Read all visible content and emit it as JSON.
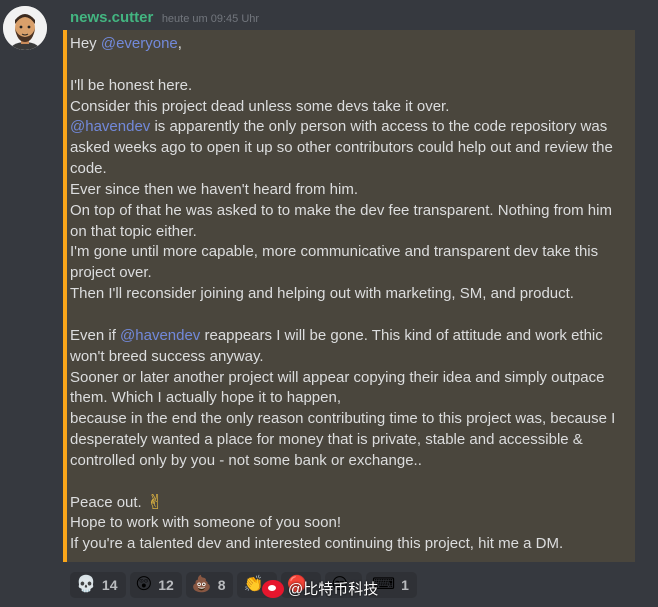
{
  "author": {
    "username": "news.cutter",
    "timestamp": "heute um 09:45 Uhr"
  },
  "message": {
    "accent_color": "#faa61a",
    "lines": [
      [
        {
          "text": "Hey "
        },
        {
          "text": "@everyone",
          "mention": true
        },
        {
          "text": ","
        }
      ],
      [],
      [
        {
          "text": "I'll be honest here."
        }
      ],
      [
        {
          "text": "Consider this project dead unless some devs take it over."
        }
      ],
      [
        {
          "text": "@havendev",
          "mention": true
        },
        {
          "text": " is apparently the only person with access to the code repository was"
        }
      ],
      [
        {
          "text": "asked weeks ago to open it up so other contributors could help out and review the"
        }
      ],
      [
        {
          "text": "code."
        }
      ],
      [
        {
          "text": "Ever since then we haven't heard from him."
        }
      ],
      [
        {
          "text": "On top of that he was asked to to make the dev fee transparent. Nothing from him"
        }
      ],
      [
        {
          "text": "on that topic either."
        }
      ],
      [
        {
          "text": "I'm gone until more capable, more communicative and transparent dev take this"
        }
      ],
      [
        {
          "text": "project over."
        }
      ],
      [
        {
          "text": "Then I'll reconsider joining and helping out with marketing, SM, and product."
        }
      ],
      [],
      [
        {
          "text": "Even if "
        },
        {
          "text": "@havendev",
          "mention": true
        },
        {
          "text": " reappears I will be gone. This kind of attitude and work ethic"
        }
      ],
      [
        {
          "text": "won't breed success anyway."
        }
      ],
      [
        {
          "text": "Sooner or later another project will appear copying their idea and simply outpace"
        }
      ],
      [
        {
          "text": "them. Which I actually hope it to happen,"
        }
      ],
      [
        {
          "text": "because in the end the only reason contributing time to this project was, because I"
        }
      ],
      [
        {
          "text": "desperately wanted a place for money that is private, stable and  accessible &"
        }
      ],
      [
        {
          "text": "controlled only by you - not some bank or exchange.."
        }
      ],
      [],
      [
        {
          "text": "Peace out."
        },
        {
          "emoji": "✌",
          "name": "victory-hand-icon"
        }
      ],
      [
        {
          "text": "Hope to work with someone of you soon!"
        }
      ],
      [
        {
          "text": "If you're a talented dev and interested continuing this project, hit me a DM."
        }
      ]
    ]
  },
  "reactions": [
    {
      "icon": "skull-icon",
      "glyph": "💀",
      "count": "14"
    },
    {
      "icon": "astonished-face-icon",
      "glyph": "😲",
      "count": "12"
    },
    {
      "icon": "pile-of-poo-icon",
      "glyph": "💩",
      "count": "8"
    },
    {
      "icon": "clapping-hands-icon",
      "glyph": "👏",
      "count": ""
    },
    {
      "icon": "red-circle-icon",
      "glyph": "🔴",
      "count": ""
    },
    {
      "icon": "face-icon",
      "glyph": "😒",
      "count": ""
    },
    {
      "icon": "keyboard-icon",
      "glyph": "⌨",
      "count": "1"
    }
  ],
  "watermark": {
    "text": "@比特币科技"
  }
}
